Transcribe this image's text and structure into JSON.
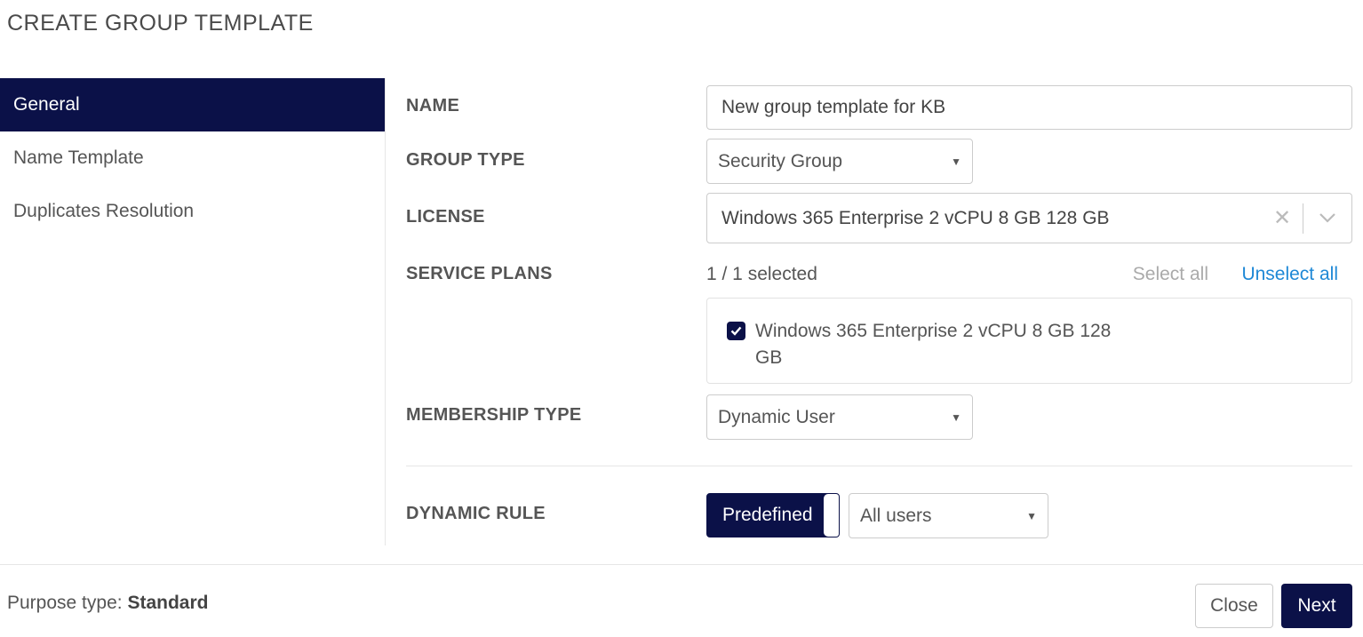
{
  "page_title": "CREATE GROUP TEMPLATE",
  "sidebar": {
    "items": [
      {
        "label": "General",
        "active": true
      },
      {
        "label": "Name Template",
        "active": false
      },
      {
        "label": "Duplicates Resolution",
        "active": false
      }
    ]
  },
  "form": {
    "name": {
      "label": "NAME",
      "value": "New group template for KB"
    },
    "group_type": {
      "label": "GROUP TYPE",
      "value": "Security Group"
    },
    "license": {
      "label": "LICENSE",
      "value": "Windows 365 Enterprise 2 vCPU 8 GB 128 GB"
    },
    "service_plans": {
      "label": "SERVICE PLANS",
      "count": "1 / 1 selected",
      "select_all": "Select all",
      "unselect_all": "Unselect all",
      "items": [
        {
          "label": "Windows 365 Enterprise 2 vCPU 8 GB 128 GB",
          "checked": true
        }
      ]
    },
    "membership_type": {
      "label": "MEMBERSHIP TYPE",
      "value": "Dynamic User"
    },
    "dynamic_rule": {
      "label": "DYNAMIC RULE",
      "mode": "Predefined",
      "value": "All users"
    }
  },
  "footer": {
    "purpose_label": "Purpose type:",
    "purpose_value": "Standard",
    "close_label": "Close",
    "next_label": "Next"
  },
  "colors": {
    "accent": "#0b1148",
    "link": "#1e88d6"
  }
}
